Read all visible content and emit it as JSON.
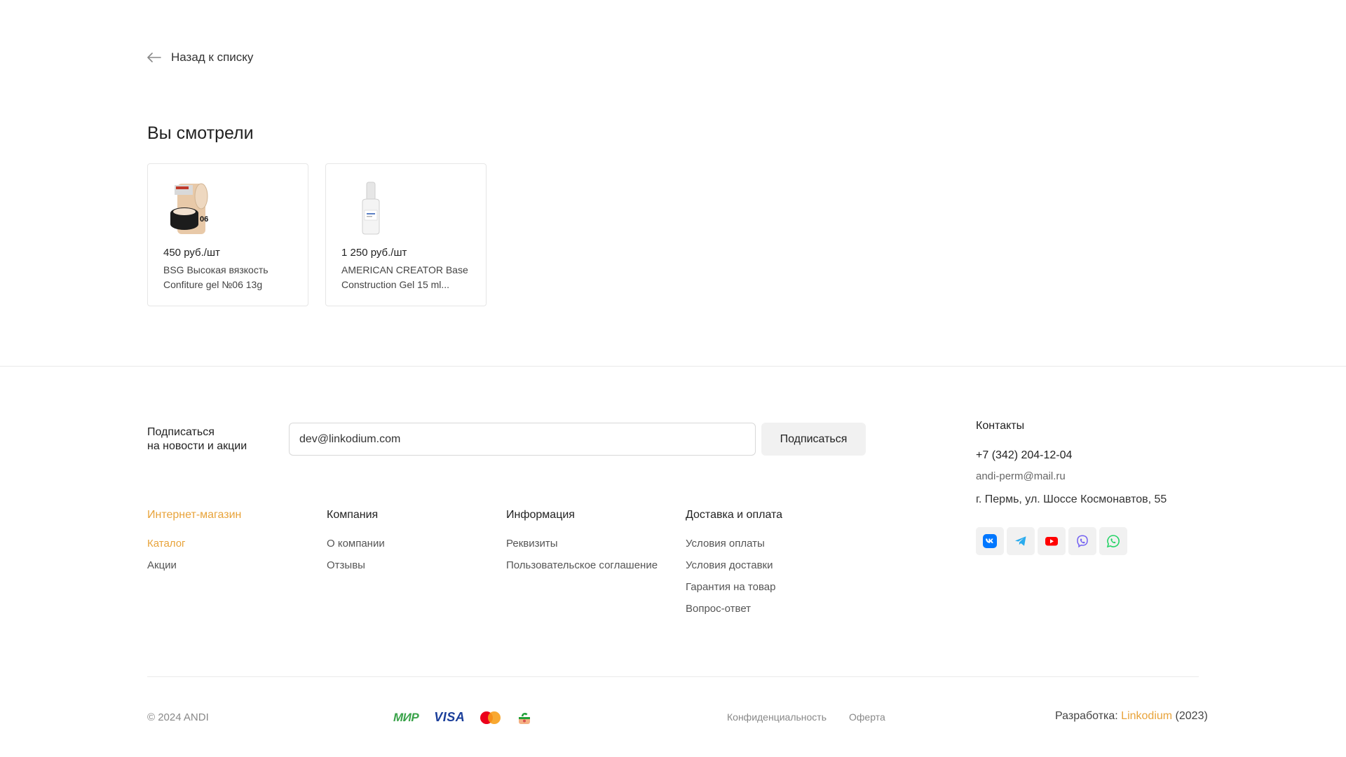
{
  "back": {
    "label": "Назад к списку"
  },
  "viewed": {
    "title": "Вы смотрели",
    "items": [
      {
        "price": "450 руб./шт",
        "name": "BSG Высокая вязкость Confiture gel №06 13g",
        "badge": "06"
      },
      {
        "price": "1 250 руб./шт",
        "name": "AMERICAN CREATOR Base Construction Gel 15 ml..."
      }
    ]
  },
  "subscribe": {
    "label": "Подписаться\nна новости и акции",
    "input_value": "dev@linkodium.com",
    "button": "Подписаться"
  },
  "footer": {
    "columns": [
      {
        "title": "Интернет-магазин",
        "links": [
          "Каталог",
          "Акции"
        ]
      },
      {
        "title": "Компания",
        "links": [
          "О компании",
          "Отзывы"
        ]
      },
      {
        "title": "Информация",
        "links": [
          "Реквизиты",
          "Пользовательское соглашение"
        ]
      },
      {
        "title": "Доставка и оплата",
        "links": [
          "Условия оплаты",
          "Условия доставки",
          "Гарантия на товар",
          "Вопрос-ответ"
        ]
      }
    ],
    "contacts": {
      "title": "Контакты",
      "phone": "+7 (342) 204-12-04",
      "email": "andi-perm@mail.ru",
      "address": "г. Пермь, ул. Шоссе Космонавтов, 55",
      "socials": [
        "vk-icon",
        "telegram-icon",
        "youtube-icon",
        "viber-icon",
        "whatsapp-icon"
      ]
    },
    "copyright": "© 2024 ANDI",
    "payments": {
      "mir": "МИР",
      "visa": "VISA"
    },
    "legal": [
      "Конфиденциальность",
      "Оферта"
    ],
    "dev": {
      "prefix": "Разработка: ",
      "brand": "Linkodium",
      "suffix": " (2023)"
    }
  },
  "colors": {
    "accent": "#e8a33a",
    "vk": "#0077ff",
    "telegram": "#2aabee",
    "youtube": "#ff0000",
    "viber": "#7360f2",
    "whatsapp": "#25d366"
  }
}
